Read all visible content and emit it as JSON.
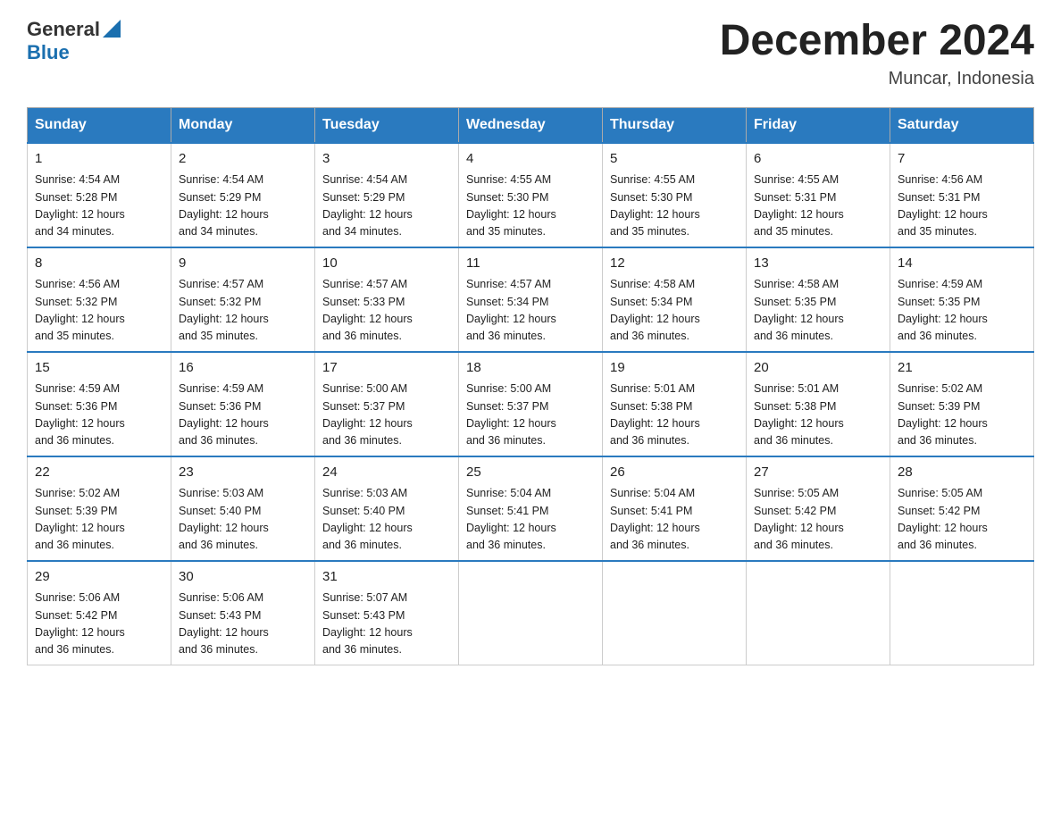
{
  "header": {
    "logo": {
      "general": "General",
      "blue": "Blue"
    },
    "title": "December 2024",
    "location": "Muncar, Indonesia"
  },
  "days_of_week": [
    "Sunday",
    "Monday",
    "Tuesday",
    "Wednesday",
    "Thursday",
    "Friday",
    "Saturday"
  ],
  "weeks": [
    [
      {
        "day": "1",
        "sunrise": "4:54 AM",
        "sunset": "5:28 PM",
        "daylight": "12 hours and 34 minutes."
      },
      {
        "day": "2",
        "sunrise": "4:54 AM",
        "sunset": "5:29 PM",
        "daylight": "12 hours and 34 minutes."
      },
      {
        "day": "3",
        "sunrise": "4:54 AM",
        "sunset": "5:29 PM",
        "daylight": "12 hours and 34 minutes."
      },
      {
        "day": "4",
        "sunrise": "4:55 AM",
        "sunset": "5:30 PM",
        "daylight": "12 hours and 35 minutes."
      },
      {
        "day": "5",
        "sunrise": "4:55 AM",
        "sunset": "5:30 PM",
        "daylight": "12 hours and 35 minutes."
      },
      {
        "day": "6",
        "sunrise": "4:55 AM",
        "sunset": "5:31 PM",
        "daylight": "12 hours and 35 minutes."
      },
      {
        "day": "7",
        "sunrise": "4:56 AM",
        "sunset": "5:31 PM",
        "daylight": "12 hours and 35 minutes."
      }
    ],
    [
      {
        "day": "8",
        "sunrise": "4:56 AM",
        "sunset": "5:32 PM",
        "daylight": "12 hours and 35 minutes."
      },
      {
        "day": "9",
        "sunrise": "4:57 AM",
        "sunset": "5:32 PM",
        "daylight": "12 hours and 35 minutes."
      },
      {
        "day": "10",
        "sunrise": "4:57 AM",
        "sunset": "5:33 PM",
        "daylight": "12 hours and 36 minutes."
      },
      {
        "day": "11",
        "sunrise": "4:57 AM",
        "sunset": "5:34 PM",
        "daylight": "12 hours and 36 minutes."
      },
      {
        "day": "12",
        "sunrise": "4:58 AM",
        "sunset": "5:34 PM",
        "daylight": "12 hours and 36 minutes."
      },
      {
        "day": "13",
        "sunrise": "4:58 AM",
        "sunset": "5:35 PM",
        "daylight": "12 hours and 36 minutes."
      },
      {
        "day": "14",
        "sunrise": "4:59 AM",
        "sunset": "5:35 PM",
        "daylight": "12 hours and 36 minutes."
      }
    ],
    [
      {
        "day": "15",
        "sunrise": "4:59 AM",
        "sunset": "5:36 PM",
        "daylight": "12 hours and 36 minutes."
      },
      {
        "day": "16",
        "sunrise": "4:59 AM",
        "sunset": "5:36 PM",
        "daylight": "12 hours and 36 minutes."
      },
      {
        "day": "17",
        "sunrise": "5:00 AM",
        "sunset": "5:37 PM",
        "daylight": "12 hours and 36 minutes."
      },
      {
        "day": "18",
        "sunrise": "5:00 AM",
        "sunset": "5:37 PM",
        "daylight": "12 hours and 36 minutes."
      },
      {
        "day": "19",
        "sunrise": "5:01 AM",
        "sunset": "5:38 PM",
        "daylight": "12 hours and 36 minutes."
      },
      {
        "day": "20",
        "sunrise": "5:01 AM",
        "sunset": "5:38 PM",
        "daylight": "12 hours and 36 minutes."
      },
      {
        "day": "21",
        "sunrise": "5:02 AM",
        "sunset": "5:39 PM",
        "daylight": "12 hours and 36 minutes."
      }
    ],
    [
      {
        "day": "22",
        "sunrise": "5:02 AM",
        "sunset": "5:39 PM",
        "daylight": "12 hours and 36 minutes."
      },
      {
        "day": "23",
        "sunrise": "5:03 AM",
        "sunset": "5:40 PM",
        "daylight": "12 hours and 36 minutes."
      },
      {
        "day": "24",
        "sunrise": "5:03 AM",
        "sunset": "5:40 PM",
        "daylight": "12 hours and 36 minutes."
      },
      {
        "day": "25",
        "sunrise": "5:04 AM",
        "sunset": "5:41 PM",
        "daylight": "12 hours and 36 minutes."
      },
      {
        "day": "26",
        "sunrise": "5:04 AM",
        "sunset": "5:41 PM",
        "daylight": "12 hours and 36 minutes."
      },
      {
        "day": "27",
        "sunrise": "5:05 AM",
        "sunset": "5:42 PM",
        "daylight": "12 hours and 36 minutes."
      },
      {
        "day": "28",
        "sunrise": "5:05 AM",
        "sunset": "5:42 PM",
        "daylight": "12 hours and 36 minutes."
      }
    ],
    [
      {
        "day": "29",
        "sunrise": "5:06 AM",
        "sunset": "5:42 PM",
        "daylight": "12 hours and 36 minutes."
      },
      {
        "day": "30",
        "sunrise": "5:06 AM",
        "sunset": "5:43 PM",
        "daylight": "12 hours and 36 minutes."
      },
      {
        "day": "31",
        "sunrise": "5:07 AM",
        "sunset": "5:43 PM",
        "daylight": "12 hours and 36 minutes."
      },
      null,
      null,
      null,
      null
    ]
  ],
  "labels": {
    "sunrise": "Sunrise:",
    "sunset": "Sunset:",
    "daylight": "Daylight:"
  }
}
